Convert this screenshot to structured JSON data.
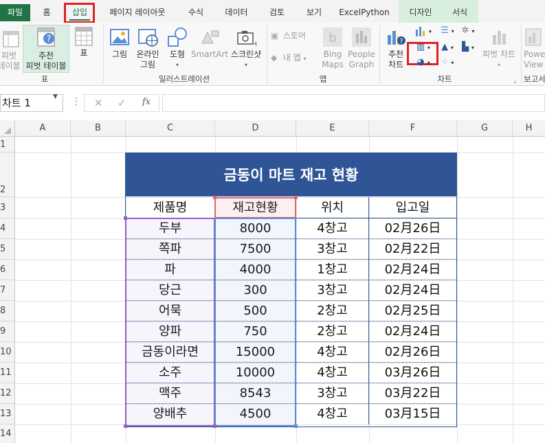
{
  "ribbon_tabs": {
    "file": "파일",
    "home": "홈",
    "insert": "삽입",
    "page_layout": "페이지 레이아웃",
    "formulas": "수식",
    "data": "데이터",
    "review": "검토",
    "view": "보기",
    "excelpython": "ExcelPython",
    "design": "디자인",
    "format": "서식"
  },
  "ribbon": {
    "pivot_table": [
      "피벗",
      "테이블"
    ],
    "recommended_pivot": [
      "추천",
      "피벗 테이블"
    ],
    "table": "표",
    "group_tables": "표",
    "pictures": "그림",
    "online_pictures": [
      "온라인",
      "그림"
    ],
    "shapes": "도형",
    "smartart": "SmartArt",
    "screenshot": "스크린샷",
    "group_illustrations": "일러스트레이션",
    "store": "스토어",
    "my_apps": "내 앱",
    "bing_maps": [
      "Bing",
      "Maps"
    ],
    "people_graph": [
      "People",
      "Graph"
    ],
    "group_apps": "앱",
    "recommended_charts": [
      "추천",
      "차트"
    ],
    "pivot_chart": "피벗 차트",
    "group_charts": "차트",
    "power_view": [
      "Powe",
      "View"
    ],
    "group_reports": "보고서"
  },
  "formula_bar": {
    "name_box": "차트 1",
    "fx": "fx",
    "formula": ""
  },
  "columns": [
    "A",
    "B",
    "C",
    "D",
    "E",
    "F",
    "G",
    "H"
  ],
  "rows": [
    "1",
    "2",
    "3",
    "4",
    "5",
    "6",
    "7",
    "8",
    "9",
    "10",
    "11",
    "12",
    "13",
    "14"
  ],
  "table": {
    "title": "금동이 마트 재고 현황",
    "headers": [
      "제품명",
      "재고현황",
      "위치",
      "입고일"
    ],
    "rows": [
      [
        "두부",
        "8000",
        "4창고",
        "02月26日"
      ],
      [
        "쪽파",
        "7500",
        "3창고",
        "02月22日"
      ],
      [
        "파",
        "4000",
        "1창고",
        "02月24日"
      ],
      [
        "당근",
        "300",
        "3창고",
        "02月24日"
      ],
      [
        "어묵",
        "500",
        "2창고",
        "02月25日"
      ],
      [
        "양파",
        "750",
        "2창고",
        "02月24日"
      ],
      [
        "금동이라면",
        "15000",
        "4창고",
        "02月26日"
      ],
      [
        "소주",
        "10000",
        "4창고",
        "03月26日"
      ],
      [
        "맥주",
        "8543",
        "3창고",
        "03月22日"
      ],
      [
        "양배추",
        "4500",
        "4창고",
        "03月15日"
      ]
    ]
  },
  "colors": {
    "excel_green": "#217346",
    "title_fill": "#2f5597",
    "highlight_red": "#e02020",
    "selection_purple": "#8b62c9",
    "selection_blue": "#5b8ed6",
    "selection_pink": "#e0646e"
  }
}
